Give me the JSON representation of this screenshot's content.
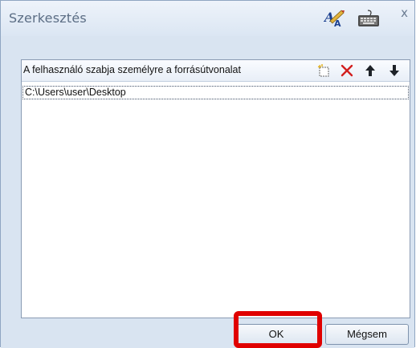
{
  "window": {
    "title": "Szerkesztés",
    "close_glyph": "x",
    "toolbar_icons": [
      "spelling-icon",
      "keyboard-icon"
    ]
  },
  "list": {
    "header_label": "A felhasználó szabja személyre a forrásútvonalat",
    "header_actions": [
      "new-item-icon",
      "delete-icon",
      "move-up-icon",
      "move-down-icon"
    ],
    "items": [
      "C:\\Users\\user\\Desktop"
    ]
  },
  "buttons": {
    "ok_label": "OK",
    "cancel_label": "Mégsem"
  },
  "colors": {
    "highlight": "#e00000",
    "delete": "#d21f1f",
    "background": "#d9e4f1"
  }
}
